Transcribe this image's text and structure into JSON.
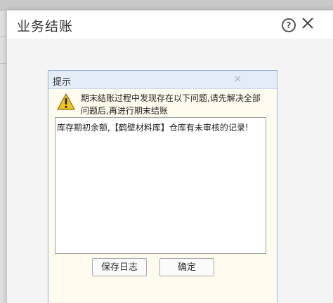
{
  "window": {
    "title": "业务结账",
    "help_icon": "help-icon",
    "close_icon": "close-icon"
  },
  "prompt": {
    "title": "提示",
    "close_glyph": "×",
    "warning_icon": "warning-icon",
    "message": "期末结账过程中发现存在以下问题,请先解决全部问题后,再进行期末结账",
    "log_text": "库存期初余额,【鹤壁材料库】仓库有未审核的记录!",
    "save_log_label": "保存日志",
    "confirm_label": "确定"
  },
  "colors": {
    "warning_fill": "#f5c518",
    "prompt_border": "#9db7d4",
    "titlebar_bg": "#e4edf7"
  }
}
